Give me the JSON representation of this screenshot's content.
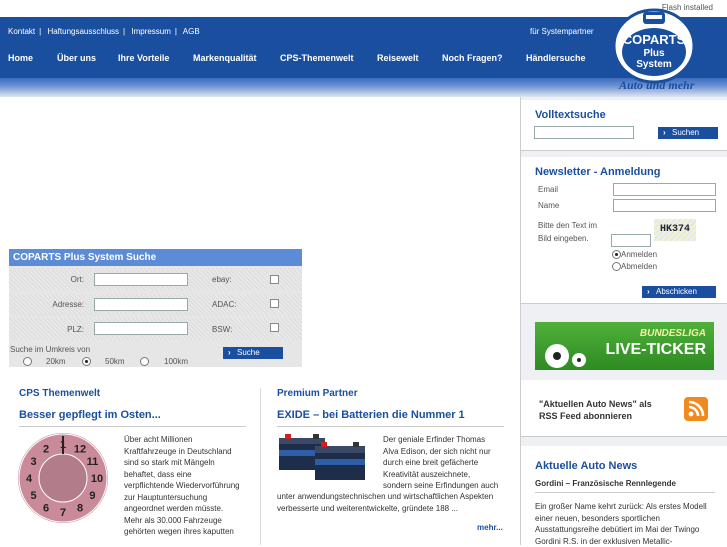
{
  "header": {
    "flash_notice": "Flash installed",
    "top_links": [
      "Kontakt",
      "Haftungsausschluss",
      "Impressum",
      "AGB"
    ],
    "separator": "|",
    "partner_link": "für Systempartner",
    "nav": [
      "Home",
      "Über uns",
      "Ihre Vorteile",
      "Markenqualität",
      "CPS-Themenwelt",
      "Reisewelt",
      "Noch Fragen?",
      "Händlersuche"
    ],
    "logo": {
      "line1": "COPARTS",
      "line2": "Plus",
      "line3": "System"
    },
    "slogan": "Auto und mehr"
  },
  "colors": {
    "brand_blue": "#1a4f9f",
    "search_head": "#5c8cd6",
    "orange_rss": "#f08a1e",
    "bundesliga_green": "#3a9a2a"
  },
  "search": {
    "title": "COPARTS Plus System Suche",
    "ort_label": "Ort:",
    "adresse_label": "Adresse:",
    "plz_label": "PLZ:",
    "ebay_label": "ebay:",
    "adac_label": "ADAC:",
    "bsw_label": "BSW:",
    "radius_label": "Suche im Umkreis von",
    "radius_options": [
      "20km",
      "50km",
      "100km"
    ],
    "radius_selected": "50km",
    "submit": "Suche"
  },
  "left_col": {
    "heading": "CPS Themenwelt",
    "article_title": "Besser gepflegt im Osten...",
    "article_text": [
      "Über acht Millionen",
      "Kraftfahrzeuge in Deutschland",
      "sind so stark mit Mängeln",
      "behaftet, dass eine",
      "verpflichtende Wiedervorführung",
      "zur Hauptuntersuchung",
      "angeordnet werden müsste.",
      "Mehr als 30.000 Fahrzeuge",
      "gehörten wegen ihres kaputten"
    ],
    "image_icon": "tuv-sticker-icon",
    "sticker_numbers": [
      "1",
      "12",
      "11",
      "10",
      "9",
      "8",
      "7",
      "6",
      "5",
      "4",
      "3",
      "2"
    ]
  },
  "mid_col": {
    "heading": "Premium Partner",
    "article_title": "EXIDE – bei Batterien die Nummer 1",
    "article_text_side": [
      "Der geniale Erfinder Thomas",
      "Alva Edison, der sich nicht nur",
      "durch eine breit gefächerte",
      "Kreativität auszeichnete,",
      "sondern seine Erfindungen auch"
    ],
    "article_text_full": [
      "unter anwendungstechnischen und wirtschaftlichen Aspekten",
      "verbesserte und weiterentwickelte, gründete 188 ..."
    ],
    "more_link": "mehr...",
    "image_icon": "battery-icon"
  },
  "sidebar": {
    "volltext": {
      "title": "Volltextsuche",
      "button": "Suchen"
    },
    "newsletter": {
      "title": "Newsletter - Anmeldung",
      "email_label": "Email",
      "name_label": "Name",
      "captcha_label": [
        "Bitte den Text im",
        "Bild eingeben."
      ],
      "captcha_text": "HK374",
      "options": [
        "Anmelden",
        "Abmelden"
      ],
      "selected": "Anmelden",
      "button": "Abschicken"
    },
    "bundesliga": {
      "line1": "BUNDESLIGA",
      "line2": "LIVE-TICKER"
    },
    "rss": {
      "text_line1": "\"Aktuellen Auto News\" als",
      "text_line2": "RSS Feed abonnieren",
      "icon": "rss-icon"
    },
    "news": {
      "title": "Aktuelle Auto News",
      "item_title": "Gordini – Französische Rennlegende",
      "item_text": [
        "Ein großer Name kehrt zurück: Als erstes Modell",
        "einer neuen, besonders sportlichen",
        "Ausstattungsreihe debütiert im Mai der Twingo",
        "Gordini R.S. in der exklusiven Metallic-"
      ]
    }
  }
}
